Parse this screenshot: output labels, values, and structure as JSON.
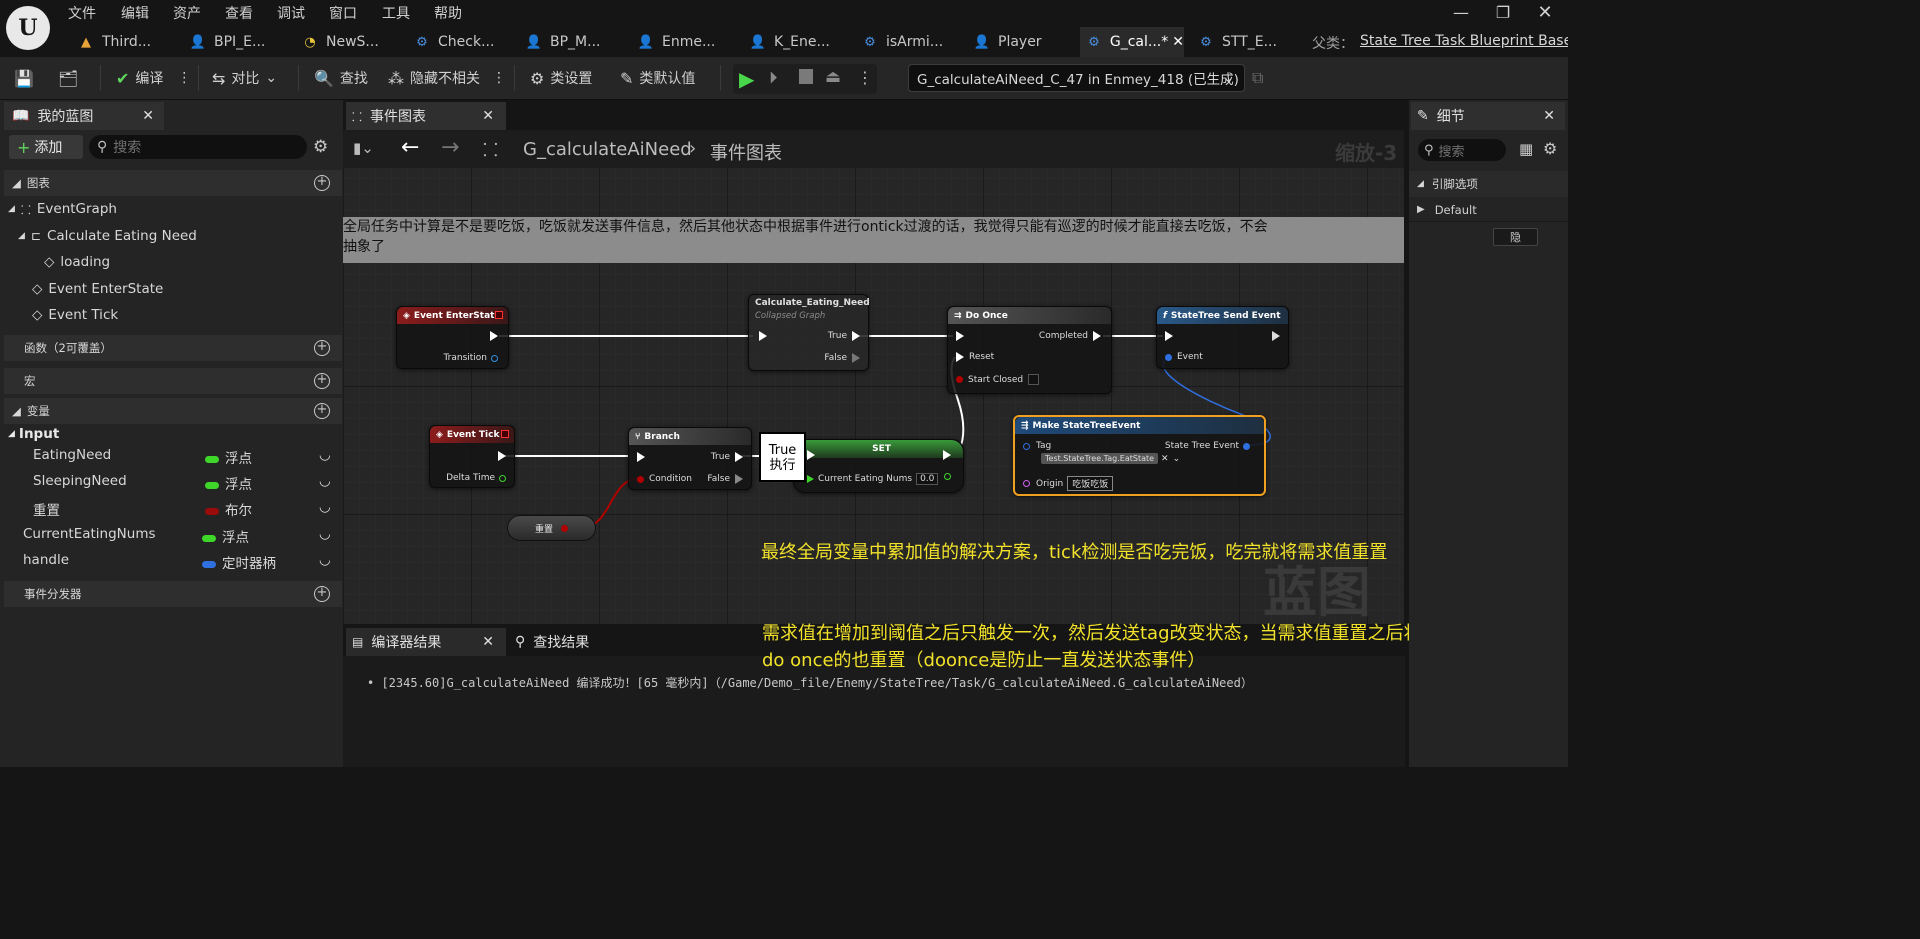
{
  "menu": [
    "文件",
    "编辑",
    "资产",
    "查看",
    "调试",
    "窗口",
    "工具",
    "帮助"
  ],
  "tabs": [
    {
      "label": "Third...",
      "icon": "warning-triangle-icon",
      "color": "#e8a23a"
    },
    {
      "label": "BPI_E...",
      "icon": "person-icon",
      "color": "#4a8fe0"
    },
    {
      "label": "NewS...",
      "icon": "pacman-icon",
      "color": "#e8c53a"
    },
    {
      "label": "Check...",
      "icon": "settings-graph-icon",
      "color": "#4a8fe0"
    },
    {
      "label": "BP_M...",
      "icon": "person-icon",
      "color": "#4a8fe0"
    },
    {
      "label": "Enme...",
      "icon": "person-icon",
      "color": "#4a8fe0"
    },
    {
      "label": "K_Ene...",
      "icon": "person-icon",
      "color": "#4a8fe0"
    },
    {
      "label": "isArmi...",
      "icon": "settings-graph-icon",
      "color": "#4a8fe0"
    },
    {
      "label": "Player",
      "icon": "person-icon",
      "color": "#4a8fe0"
    },
    {
      "label": "G_cal...*",
      "icon": "settings-graph-icon",
      "color": "#4a8fe0",
      "active": true
    },
    {
      "label": "STT_E...",
      "icon": "settings-graph-icon",
      "color": "#4a8fe0"
    }
  ],
  "parent_label": "父类：",
  "parent_value": "State Tree Task Blueprint Base",
  "toolbar": {
    "compile": "编译",
    "diff": "对比",
    "find": "查找",
    "hide_unrelated": "隐藏不相关",
    "class_settings": "类设置",
    "class_defaults": "类默认值",
    "debug_object": "G_calculateAiNeed_C_47 in Enmey_418 (已生成)"
  },
  "left": {
    "tab_title": "我的蓝图",
    "add_label": "添加",
    "search_placeholder": "搜索",
    "graphs_section": "图表",
    "event_graph": "EventGraph",
    "collapsed": "Calculate Eating Need",
    "loading": "loading",
    "event_enter": "Event EnterState",
    "event_tick": "Event Tick",
    "functions_section": "函数（2可覆盖）",
    "macros_section": "宏",
    "variables_section": "变量",
    "input_category": "Input",
    "variables": [
      {
        "name": "EatingNeed",
        "type": "浮点",
        "color": "#3fd62a"
      },
      {
        "name": "SleepingNeed",
        "type": "浮点",
        "color": "#3fd62a"
      },
      {
        "name": "重置",
        "type": "布尔",
        "color": "#9a0c0c"
      },
      {
        "name": "CurrentEatingNums",
        "type": "浮点",
        "color": "#3fd62a"
      },
      {
        "name": "handle",
        "type": "定时器柄",
        "color": "#2f6fe0"
      }
    ],
    "dispatchers_section": "事件分发器"
  },
  "graph": {
    "tab_title": "事件图表",
    "breadcrumb_root": "G_calculateAiNeed",
    "breadcrumb_leaf": "事件图表",
    "zoom": "缩放-3",
    "watermark": "蓝图",
    "comment": "全局任务中计算是不是要吃饭，吃饭就发送事件信息，然后其他状态中根据事件进行ontick过渡的话，我觉得只能有巡逻的时候才能直接去吃饭，不会\n抽象了",
    "nodes": {
      "enter_state": {
        "title": "Event EnterState",
        "pin_transition": "Transition"
      },
      "calc": {
        "title": "Calculate_Eating_Need",
        "subtitle": "Collapsed Graph",
        "pin_true": "True",
        "pin_false": "False"
      },
      "do_once": {
        "title": "Do Once",
        "pin_completed": "Completed",
        "pin_reset": "Reset",
        "pin_start_closed": "Start Closed"
      },
      "send_event": {
        "title": "StateTree Send Event",
        "pin_event": "Event"
      },
      "event_tick": {
        "title": "Event Tick",
        "pin_delta": "Delta Time"
      },
      "branch": {
        "title": "Branch",
        "pin_condition": "Condition",
        "pin_true": "True",
        "pin_false": "False"
      },
      "tooltip_true": "True",
      "tooltip_exec": "执行",
      "set": {
        "title": "SET",
        "pin_var": "Current Eating Nums",
        "value": "0.0"
      },
      "make_event": {
        "title": "Make StateTreeEvent",
        "pin_tag": "Tag",
        "tag_value": "Test.StateTree.Tag.EatState",
        "pin_origin": "Origin",
        "origin_value": "吃饭吃饭",
        "pin_out": "State Tree Event"
      },
      "reset_var": {
        "title": "重置"
      }
    }
  },
  "annotations": {
    "line1": "最终全局变量中累加值的解决方案，tick检测是否吃完饭，吃完就将需求值重置",
    "line2": "需求值在增加到阈值之后只触发一次，然后发送tag改变状态，当需求值重置之后将",
    "line3": "do once的也重置（doonce是防止一直发送状态事件）"
  },
  "bottom": {
    "compiler_tab": "编译器结果",
    "find_tab": "查找结果",
    "log": "[2345.60]G_calculateAiNeed 编译成功！[65 毫秒内]（/Game/Demo_file/Enemy/StateTree/Task/G_calculateAiNeed.G_calculateAiNeed）"
  },
  "right": {
    "tab_title": "细节",
    "search_placeholder": "搜索",
    "section": "引脚选项",
    "default_label": "Default",
    "hide_button": "隐"
  }
}
